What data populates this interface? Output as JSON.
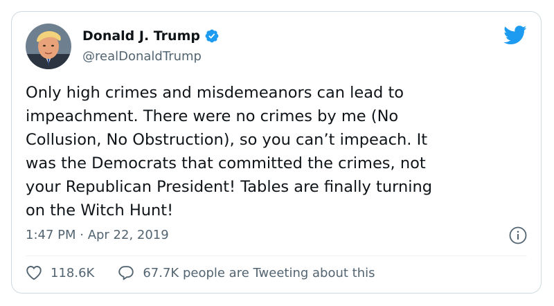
{
  "author": {
    "display_name": "Donald J. Trump",
    "handle": "@realDonaldTrump",
    "verified": true,
    "verified_icon": "verified-badge-icon",
    "avatar": "profile-photo"
  },
  "tweet": {
    "text": "Only high crimes and misdemeanors can lead to\nimpeachment. There were no crimes by me (No\nCollusion, No Obstruction), so you can’t impeach. It\nwas the Democrats that committed the crimes, not\nyour Republican President! Tables are finally turning\non the Witch Hunt!",
    "timestamp": "1:47 PM · Apr 22, 2019"
  },
  "engagement": {
    "likes": "118.6K",
    "tweeting_about": "67.7K people are Tweeting about this"
  },
  "icons": {
    "brand": "twitter-bird-icon",
    "info": "info-icon",
    "like": "heart-icon",
    "reply": "speech-bubble-icon"
  },
  "colors": {
    "brand": "#1d9bf0",
    "text_primary": "#0f1419",
    "text_secondary": "#536471",
    "border": "#cfd9de"
  }
}
